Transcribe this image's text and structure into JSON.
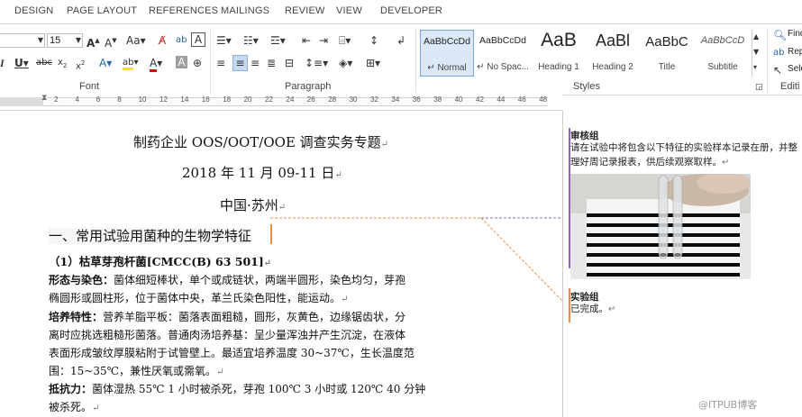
{
  "tabs": [
    "DESIGN",
    "PAGE LAYOUT",
    "REFERENCES",
    "MAILINGS",
    "REVIEW",
    "VIEW",
    "DEVELOPER"
  ],
  "ribbon": {
    "font_size": "15",
    "font_group_label": "Font",
    "paragraph_group_label": "Paragraph",
    "styles_group_label": "Styles",
    "editing_group_label": "Editi",
    "styles": [
      {
        "sample": "AaBbCcDd",
        "name": "↵ Normal"
      },
      {
        "sample": "AaBbCcDd",
        "name": "↵ No Spac..."
      },
      {
        "sample": "AaB",
        "name": "Heading 1"
      },
      {
        "sample": "AaBl",
        "name": "Heading 2"
      },
      {
        "sample": "AaBbC",
        "name": "Title"
      },
      {
        "sample": "AaBbCcD",
        "name": "Subtitle"
      }
    ],
    "editing": [
      "Find",
      "Rep",
      "Sele"
    ]
  },
  "ruler": {
    "numbers": [
      "2",
      "4",
      "6",
      "8",
      "10",
      "12",
      "14",
      "16",
      "18",
      "20",
      "22",
      "24",
      "26",
      "28",
      "30",
      "32",
      "34",
      "36",
      "38",
      "40",
      "42",
      "44",
      "46",
      "48"
    ]
  },
  "document": {
    "title": "制药企业 OOS/OOT/OOE 调查实务专题",
    "date": "2018 年 11 月 09-11 日",
    "location": "中国·苏州",
    "section_heading": "一、常用试验用菌种的生物学特征",
    "subheading": "（1）枯草芽孢杆菌[CMCC(B) 63 501]",
    "lines": [
      {
        "label": "形态与染色：",
        "text": "菌体细短棒状，单个或成链状，两端半圆形，染色均匀，芽孢"
      },
      {
        "label": "",
        "text": "椭圆形或圆柱形，位于菌体中央，革兰氏染色阳性，能运动。"
      },
      {
        "label": "培养特性：",
        "text": "营养羊脂平板：菌落表面粗糙，圆形，灰黄色，边缘锯齿状，分"
      },
      {
        "label": "",
        "text": "离时应挑选粗糙形菌落。普通肉汤培养基：呈少量浑浊并产生沉淀，在液体"
      },
      {
        "label": "",
        "text": "表面形成皱纹厚膜粘附于试管壁上。最适宜培养温度 30~37℃，生长温度范"
      },
      {
        "label": "",
        "text": "围：15~35℃，兼性厌氧或需氧。"
      },
      {
        "label": "抵抗力：",
        "text": "菌体湿热 55℃ 1 小时被杀死，芽孢 100℃ 3 小时或 120℃ 40 分钟"
      },
      {
        "label": "",
        "text": "被杀死。"
      }
    ]
  },
  "comments": [
    {
      "author": "审核组",
      "text1": "请在试验中将包含以下特征的实验样本记录在册，并整",
      "text2": "理好周记录报表，供后续观察取样。",
      "color": "#8e6bb0"
    },
    {
      "author": "实验组",
      "text1": "已完成。",
      "color": "#f2894a"
    }
  ],
  "watermark": "@ITPUB博客"
}
